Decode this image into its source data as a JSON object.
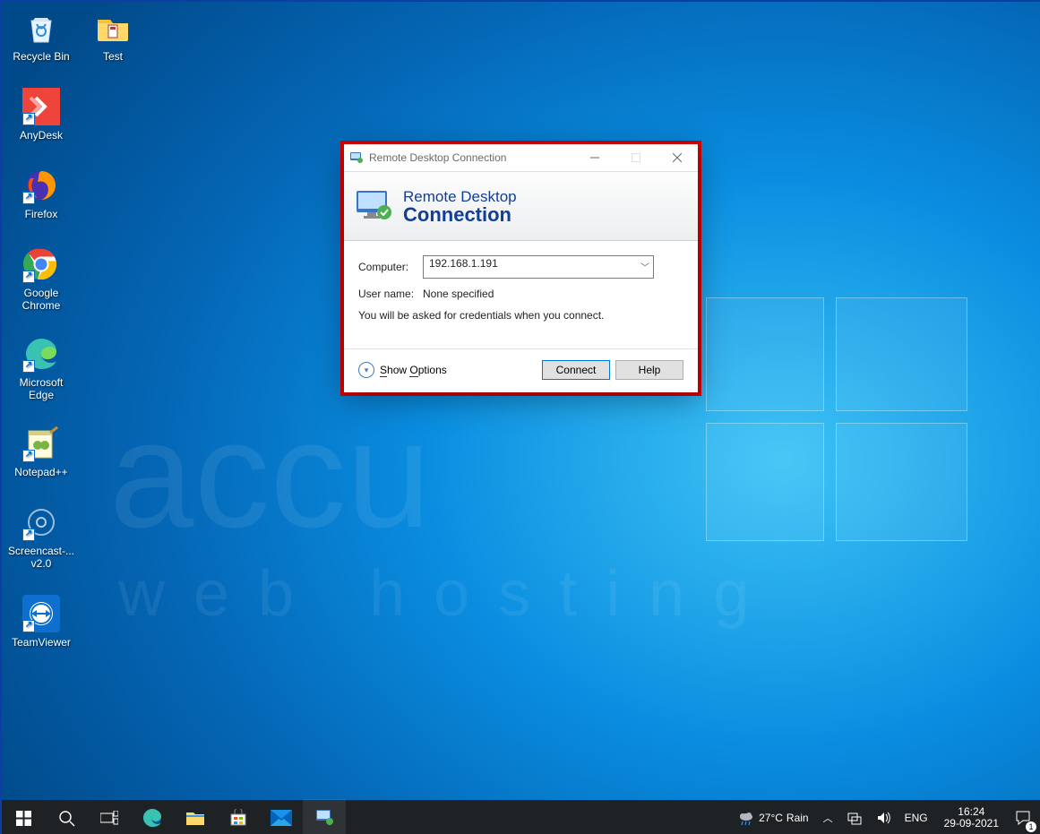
{
  "desktop_icons": [
    {
      "id": "recycle-bin",
      "label": "Recycle Bin"
    },
    {
      "id": "test-folder",
      "label": "Test"
    },
    {
      "id": "anydesk",
      "label": "AnyDesk"
    },
    {
      "id": "firefox",
      "label": "Firefox"
    },
    {
      "id": "google-chrome",
      "label": "Google Chrome"
    },
    {
      "id": "microsoft-edge",
      "label": "Microsoft Edge"
    },
    {
      "id": "notepadpp",
      "label": "Notepad++"
    },
    {
      "id": "screencast",
      "label": "Screencast-... v2.0"
    },
    {
      "id": "teamviewer",
      "label": "TeamViewer"
    }
  ],
  "watermark": {
    "line1": "accu",
    "line2": "web hosting"
  },
  "dialog": {
    "title": "Remote Desktop Connection",
    "banner_line1": "Remote Desktop",
    "banner_line2": "Connection",
    "computer_label": "Computer:",
    "computer_value": "192.168.1.191",
    "username_label": "User name:",
    "username_value": "None specified",
    "hint": "You will be asked for credentials when you connect.",
    "show_options": "Show Options",
    "connect": "Connect",
    "help": "Help"
  },
  "taskbar": {
    "weather_temp": "27°C",
    "weather_cond": "Rain",
    "lang": "ENG",
    "time": "16:24",
    "date": "29-09-2021",
    "notif_count": "1"
  }
}
